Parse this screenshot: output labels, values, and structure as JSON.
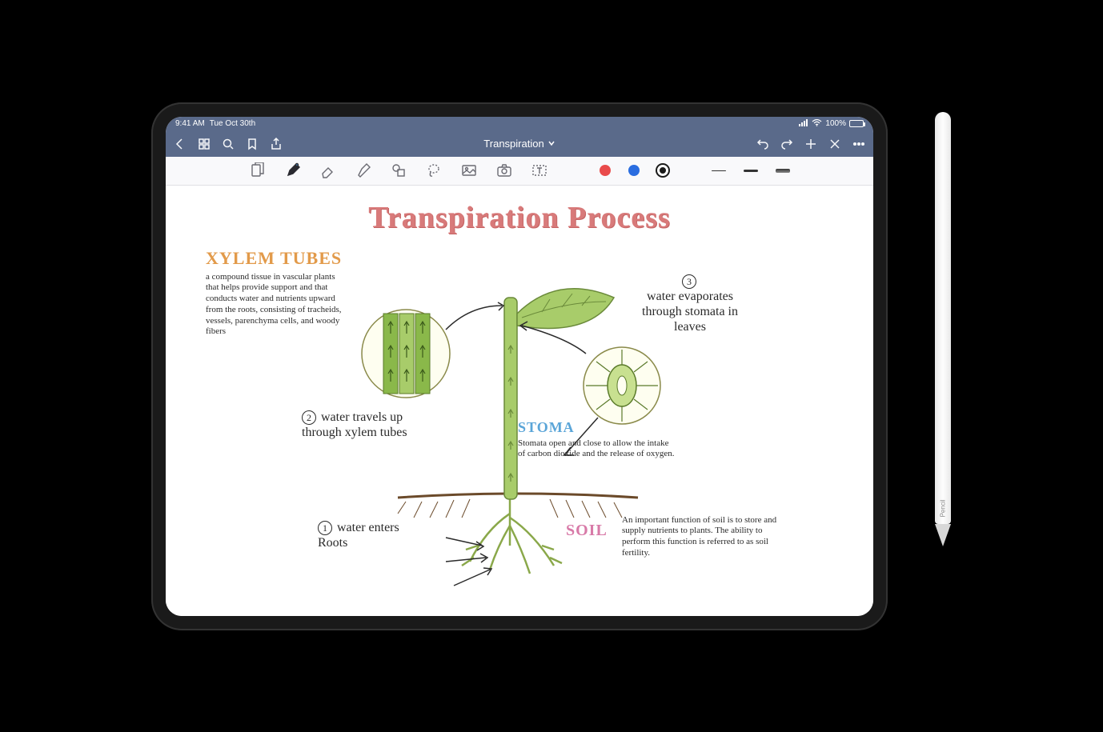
{
  "status": {
    "time": "9:41 AM",
    "date": "Tue Oct 30th",
    "battery": "100%"
  },
  "nav": {
    "title": "Transpiration"
  },
  "colors": {
    "red": "#e94b4b",
    "blue": "#2a6de0",
    "black": "#1a1a1a"
  },
  "note": {
    "title": "Transpiration Process",
    "xylem": {
      "label": "XYLEM TUBES",
      "body": "a compound tissue in vascular plants that helps provide support and that conducts water and nutrients upward from the roots, consisting of tracheids, vessels, parenchyma cells, and woody fibers"
    },
    "stoma": {
      "label": "STOMA",
      "body": "Stomata open and close to allow the intake of carbon dioxide and the release of oxygen."
    },
    "soil": {
      "label": "SOIL",
      "body": "An important function of soil is to store and supply nutrients to plants. The ability to perform this function is referred to as soil fertility."
    },
    "steps": {
      "s1": "water enters Roots",
      "s2": "water travels up through xylem tubes",
      "s3": "water evaporates through stomata in leaves"
    }
  },
  "pencil": {
    "label": "Pencil"
  }
}
